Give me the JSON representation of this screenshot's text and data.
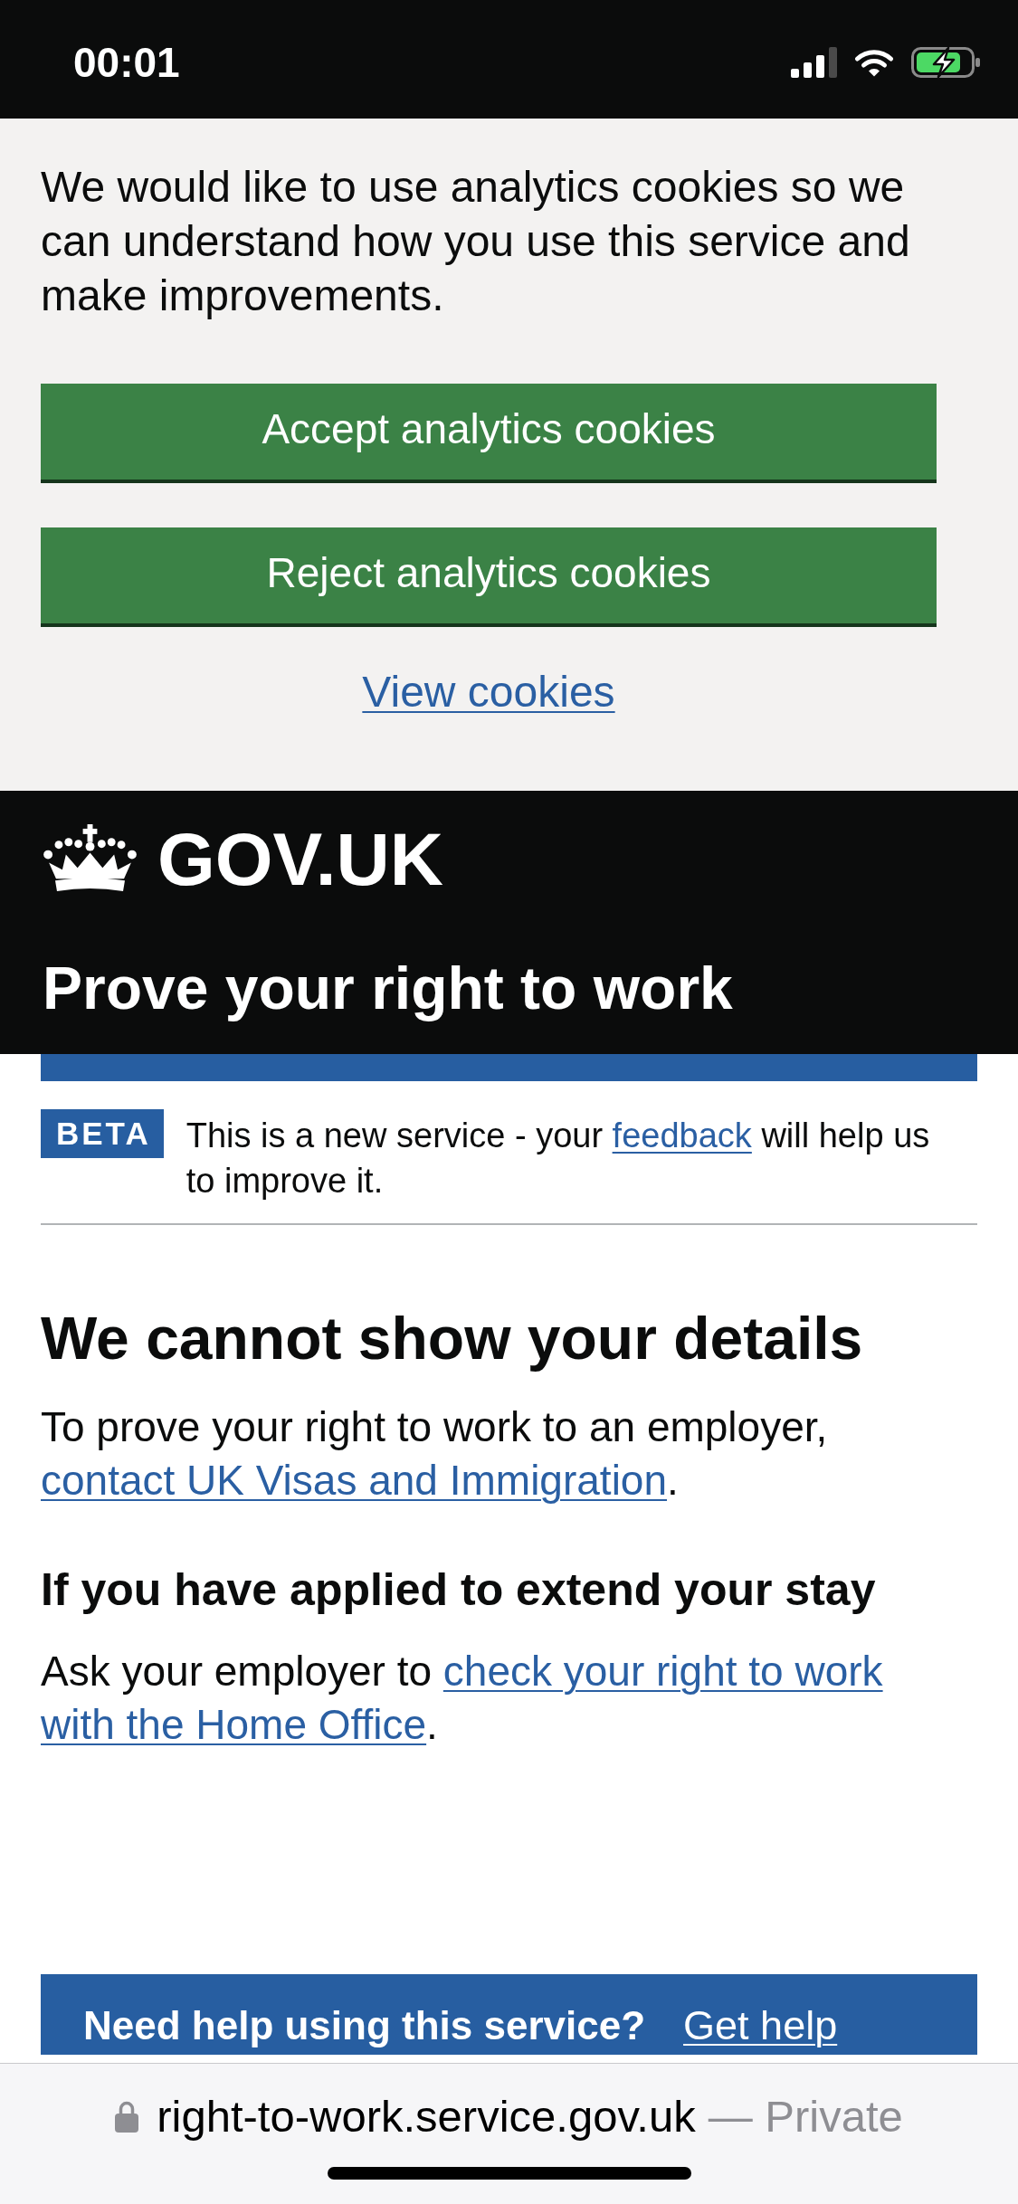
{
  "status_bar": {
    "time": "00:01"
  },
  "cookie_banner": {
    "message": "We would like to use analytics cookies so we can understand how you use this service and make improvements.",
    "buttons": [
      {
        "label": "Accept analytics cookies"
      },
      {
        "label": "Reject analytics cookies"
      }
    ],
    "link": "View cookies"
  },
  "header": {
    "logo_text": "GOV.UK",
    "service_name": "Prove your right to work"
  },
  "phase_banner": {
    "tag": "BETA",
    "lines": [
      [
        {
          "kind": "text",
          "text": "This is a new service - your "
        },
        {
          "kind": "link",
          "text": "feedback"
        },
        {
          "kind": "text",
          "text": " will help us"
        }
      ],
      [
        {
          "kind": "text",
          "text": "to improve it."
        }
      ]
    ]
  },
  "content": [
    {
      "kind": "heading_large",
      "text": "We cannot show your details"
    },
    {
      "kind": "paragraph",
      "lines": [
        [
          {
            "kind": "text",
            "text": "To prove your right to work to an employer,"
          }
        ],
        [
          {
            "kind": "link",
            "text": "contact UK Visas and Immigration"
          },
          {
            "kind": "text",
            "text": "."
          }
        ]
      ]
    },
    {
      "kind": "heading_medium",
      "text": "If you have applied to extend your stay"
    },
    {
      "kind": "paragraph",
      "lines": [
        [
          {
            "kind": "text",
            "text": "Ask your employer to "
          },
          {
            "kind": "link",
            "text": "check your right to work"
          }
        ],
        [
          {
            "kind": "link",
            "text": "with the Home Office"
          },
          {
            "kind": "text",
            "text": "."
          }
        ]
      ]
    }
  ],
  "help_banner": {
    "title": "Need help using this service?",
    "link": "Get help"
  },
  "browser_bar": {
    "domain": "right-to-work.service.gov.uk",
    "label": "— Private"
  }
}
